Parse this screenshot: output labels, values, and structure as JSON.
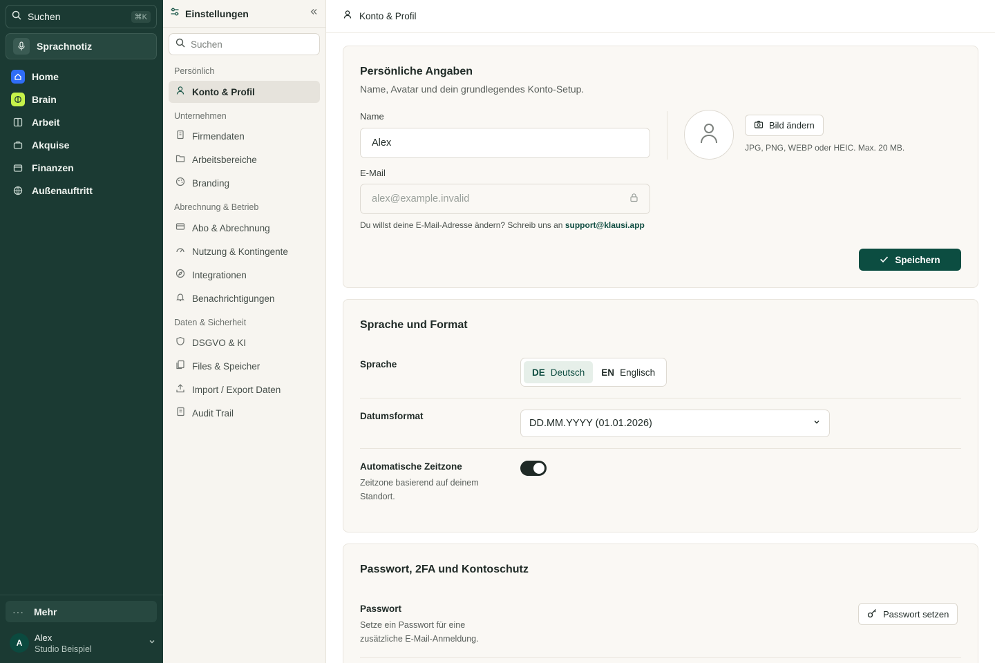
{
  "nav": {
    "search_label": "Suchen",
    "search_shortcut": "⌘K",
    "voice_label": "Sprachnotiz",
    "items": [
      {
        "label": "Home",
        "icon": "home-icon",
        "color": "#2f6df6"
      },
      {
        "label": "Brain",
        "icon": "brain-icon",
        "color": "#c6f24a"
      },
      {
        "label": "Arbeit",
        "icon": "columns-icon"
      },
      {
        "label": "Akquise",
        "icon": "briefcase-icon"
      },
      {
        "label": "Finanzen",
        "icon": "wallet-icon"
      },
      {
        "label": "Außenauftritt",
        "icon": "globe-icon"
      }
    ],
    "more_label": "Mehr",
    "user": {
      "initial": "A",
      "name": "Alex",
      "studio": "Studio Beispiel"
    }
  },
  "settings": {
    "title": "Einstellungen",
    "search_placeholder": "Suchen",
    "groups": [
      {
        "label": "Persönlich",
        "items": [
          {
            "label": "Konto & Profil",
            "icon": "user-icon",
            "active": true
          }
        ]
      },
      {
        "label": "Unternehmen",
        "items": [
          {
            "label": "Firmendaten",
            "icon": "building-icon"
          },
          {
            "label": "Arbeitsbereiche",
            "icon": "folder-icon"
          },
          {
            "label": "Branding",
            "icon": "palette-icon"
          }
        ]
      },
      {
        "label": "Abrechnung & Betrieb",
        "items": [
          {
            "label": "Abo & Abrechnung",
            "icon": "credit-card-icon"
          },
          {
            "label": "Nutzung & Kontingente",
            "icon": "gauge-icon"
          },
          {
            "label": "Integrationen",
            "icon": "compass-icon"
          },
          {
            "label": "Benachrichtigungen",
            "icon": "bell-icon"
          }
        ]
      },
      {
        "label": "Daten & Sicherheit",
        "items": [
          {
            "label": "DSGVO & KI",
            "icon": "shield-icon"
          },
          {
            "label": "Files & Speicher",
            "icon": "files-icon"
          },
          {
            "label": "Import / Export Daten",
            "icon": "upload-icon"
          },
          {
            "label": "Audit Trail",
            "icon": "scroll-icon"
          }
        ]
      }
    ]
  },
  "main": {
    "header_title": "Konto & Profil",
    "personal": {
      "title": "Persönliche Angaben",
      "subtitle": "Name, Avatar und dein grundlegendes Konto-Setup.",
      "name_label": "Name",
      "name_value": "Alex",
      "email_label": "E-Mail",
      "email_value": "alex@example.invalid",
      "email_help": "Du willst deine E-Mail-Adresse ändern? Schreib uns an",
      "support_email": "support@klausi.app",
      "change_image": "Bild ändern",
      "image_note": "JPG, PNG, WEBP oder HEIC. Max. 20 MB.",
      "save": "Speichern"
    },
    "language": {
      "title": "Sprache und Format",
      "language_label": "Sprache",
      "options": [
        {
          "code": "DE",
          "label": "Deutsch",
          "active": true
        },
        {
          "code": "EN",
          "label": "Englisch",
          "active": false
        }
      ],
      "date_label": "Datumsformat",
      "date_value": "DD.MM.YYYY (01.01.2026)",
      "tz_label": "Automatische Zeitzone",
      "tz_desc": "Zeitzone basierend auf deinem Standort.",
      "tz_enabled": true
    },
    "security": {
      "title": "Passwort, 2FA und Kontoschutz",
      "password_label": "Passwort",
      "password_desc": "Setze ein Passwort für eine zusätzliche E-Mail-Anmeldung.",
      "password_button": "Passwort setzen"
    }
  },
  "colors": {
    "brand": "#0c4d41",
    "nav_bg": "#1b3a33",
    "panel_bg": "#f7f5f0"
  }
}
